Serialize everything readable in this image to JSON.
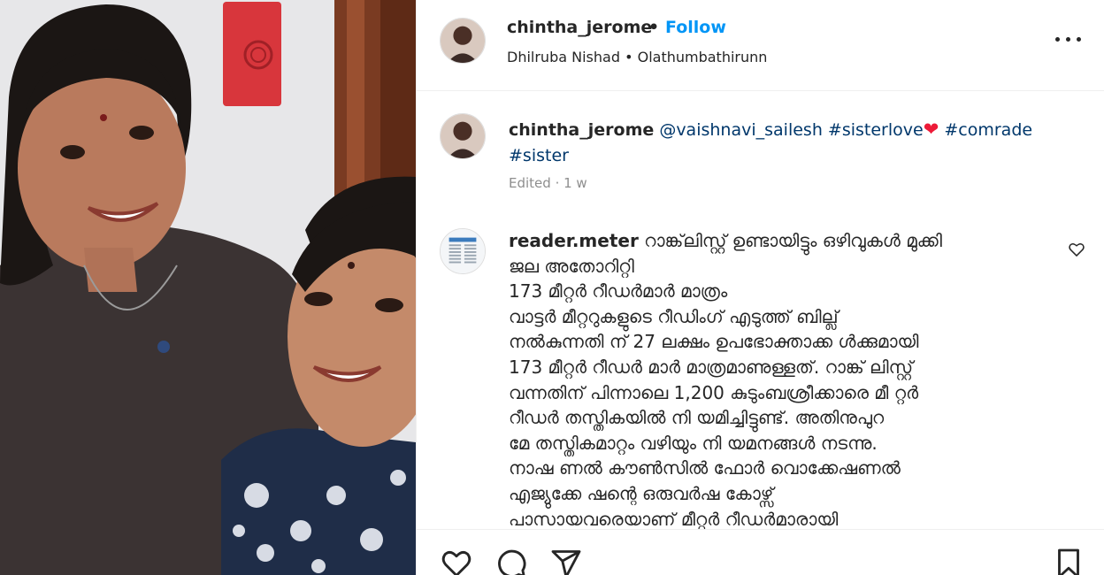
{
  "post": {
    "username": "chintha_jerome",
    "separator": "•",
    "follow_label": "Follow",
    "audio": {
      "artist": "Dhilruba Nishad",
      "sep": "•",
      "track": "Olathumbathirunn"
    }
  },
  "caption": {
    "username": "chintha_jerome",
    "mention": "@vaishnavi_sailesh",
    "tag1": "#sisterlove",
    "heart": "❤",
    "tag2": "#comrade",
    "tag3": "#sister",
    "meta": "Edited · 1 w"
  },
  "comment": {
    "username": "reader.meter",
    "lines": [
      "റാങ്ക്‌ലിസ്റ്റ് ഉണ്ടായിട്ടും ഒഴിവുകൾ മുക്കി",
      "ജല അതോറിറ്റി",
      "173 മീറ്റർ റീഡർമാർ മാത്രം",
      "വാട്ടർ മീറ്ററുകളുടെ റീഡിംഗ് എടുത്ത് ബില്ല്",
      "നൽകുന്നതി ന് 27 ലക്ഷം ഉപഭോക്താക്ക ൾക്കുമായി",
      "173 മീറ്റർ റീഡർ മാർ മാത്രമാണുള്ളത്. റാങ്ക് ലിസ്റ്റ്",
      "വന്നതിന് പിന്നാലെ 1,200 കുടുംബശ്രീക്കാരെ മീ റ്റർ",
      "റീഡർ തസ്തികയിൽ നി യമിച്ചിട്ടുണ്ട്. അതിനുപുറ",
      "മേ തസ്തികമാറ്റം വഴിയും നി യമനങ്ങൾ നടന്നു.",
      "നാഷ ണൽ കൗൺസിൽ ഫോർ വൊക്കേഷണൽ",
      "എജ്യുക്കേ ഷന്റെ ഒരുവർഷ കോഴ്സ്",
      "പാസായവരെയാണ് മീറ്റർ റീഡർമാരായി"
    ]
  },
  "icons": {
    "like": "heart-icon",
    "comment": "comment-icon",
    "share": "share-icon",
    "save": "bookmark-icon",
    "more": "more-icon"
  },
  "colors": {
    "follow": "#0095f6",
    "hashtag": "#00376b",
    "heart": "#ed1b38",
    "meta": "#8e8e8e"
  }
}
